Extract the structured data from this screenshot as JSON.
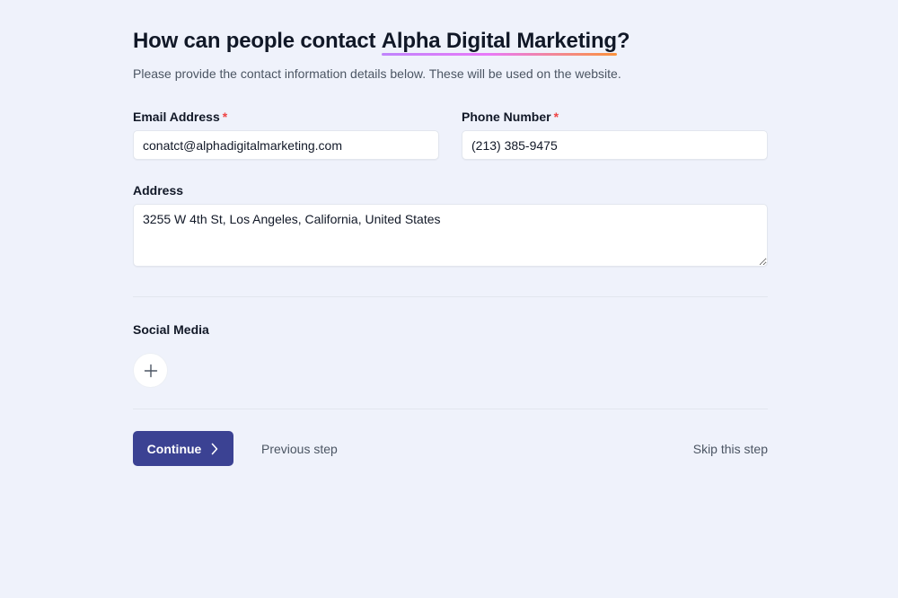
{
  "heading": {
    "prefix": "How can people contact ",
    "brand": "Alpha Digital Marketing",
    "suffix": "?"
  },
  "subtitle": "Please provide the contact information details below. These will be used on the website.",
  "email": {
    "label": "Email Address",
    "required_mark": "*",
    "value": "conatct@alphadigitalmarketing.com"
  },
  "phone": {
    "label": "Phone Number",
    "required_mark": "*",
    "value": "(213) 385-9475"
  },
  "address": {
    "label": "Address",
    "value": "3255 W 4th St, Los Angeles, California, United States"
  },
  "social": {
    "label": "Social Media"
  },
  "actions": {
    "continue_label": "Continue",
    "previous_label": "Previous step",
    "skip_label": "Skip this step"
  },
  "colors": {
    "background": "#eff2fb",
    "primary_button": "#3b4293",
    "required": "#ef4444",
    "brand_underline": [
      "#c084fc",
      "#e879f9",
      "#fb923c"
    ]
  },
  "icons": {
    "add": "plus-icon",
    "continue": "chevron-right-icon"
  }
}
